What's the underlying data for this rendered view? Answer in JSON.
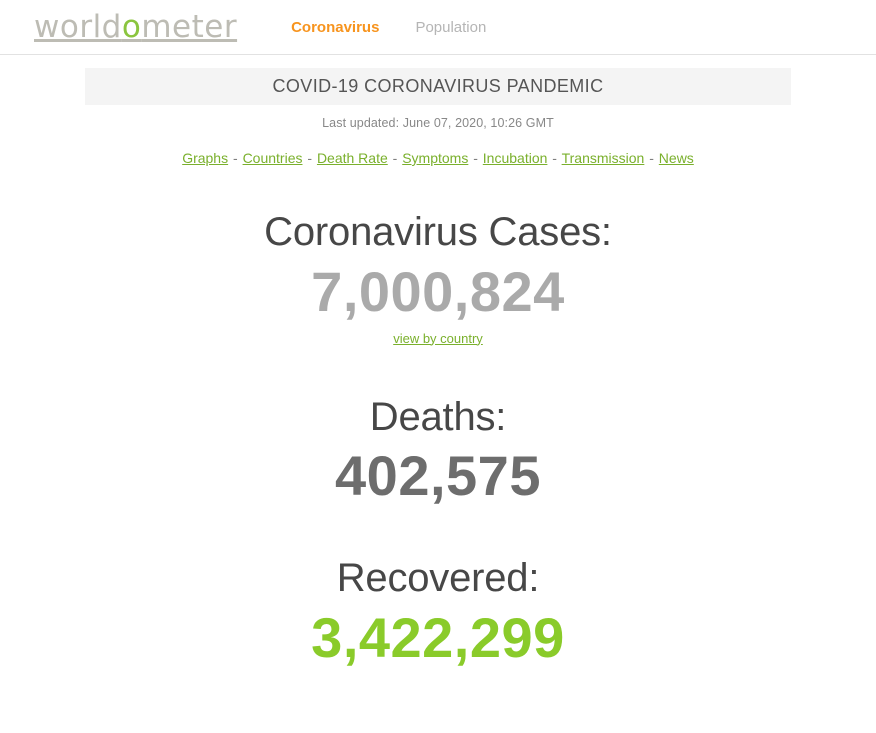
{
  "site": {
    "logo_prefix": "world",
    "logo_accent": "o",
    "logo_suffix": "meter"
  },
  "nav": {
    "items": [
      {
        "label": "Coronavirus",
        "state": "active"
      },
      {
        "label": "Population",
        "state": "inactive"
      }
    ]
  },
  "banner": {
    "title": "COVID-19 CORONAVIRUS PANDEMIC",
    "last_updated": "Last updated: June 07, 2020, 10:26 GMT"
  },
  "section_links": {
    "separator": "-",
    "items": [
      {
        "label": "Graphs"
      },
      {
        "label": "Countries"
      },
      {
        "label": "Death Rate"
      },
      {
        "label": "Symptoms"
      },
      {
        "label": "Incubation"
      },
      {
        "label": "Transmission"
      },
      {
        "label": "News"
      }
    ]
  },
  "counters": [
    {
      "title": "Coronavirus Cases:",
      "value": "7,000,824",
      "sub_link": "view by country",
      "color": "#aaaaaa"
    },
    {
      "title": "Deaths:",
      "value": "402,575",
      "sub_link": "",
      "color": "#6d6d6d"
    },
    {
      "title": "Recovered:",
      "value": "3,422,299",
      "sub_link": "",
      "color": "#8acb2a"
    }
  ],
  "colors": {
    "accent_green": "#8acb2a",
    "link_green": "#7ab02c",
    "nav_active_orange": "#f7941e",
    "banner_bg": "#f4f4f4",
    "heading_gray": "#474747"
  }
}
